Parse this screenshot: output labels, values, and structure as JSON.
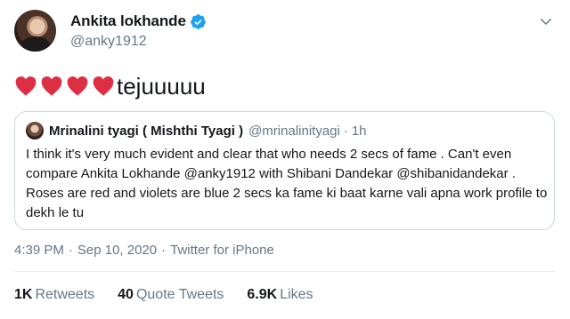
{
  "author": {
    "name": "Ankita lokhande",
    "handle": "@anky1912"
  },
  "tweet": {
    "hearts": [
      "red-heart-emoji",
      "red-heart-emoji",
      "red-heart-emoji",
      "red-heart-emoji"
    ],
    "text": "tejuuuuu"
  },
  "quote": {
    "name": "Mrinalini tyagi ( Mishthi Tyagi )",
    "handle": "@mrinalinityagi",
    "dot": "·",
    "time": "1h",
    "body": "I think it's very much evident and clear that who needs 2 secs of fame . Can't even compare Ankita Lokhande @anky1912 with Shibani Dandekar @shibanidandekar . Roses are  red and violets are blue 2 secs ka fame ki baat karne vali apna work profile to dekh le tu"
  },
  "meta": {
    "time": "4:39 PM",
    "date": "Sep 10, 2020",
    "sep": "·",
    "source": "Twitter for iPhone"
  },
  "stats": {
    "retweets_count": "1K",
    "retweets_label": "Retweets",
    "quotes_count": "40",
    "quotes_label": "Quote Tweets",
    "likes_count": "6.9K",
    "likes_label": "Likes"
  },
  "colors": {
    "verified": "#1da1f2",
    "heart": "#dd2e44",
    "secondary_text": "#657786",
    "border": "#ccd6dd"
  }
}
